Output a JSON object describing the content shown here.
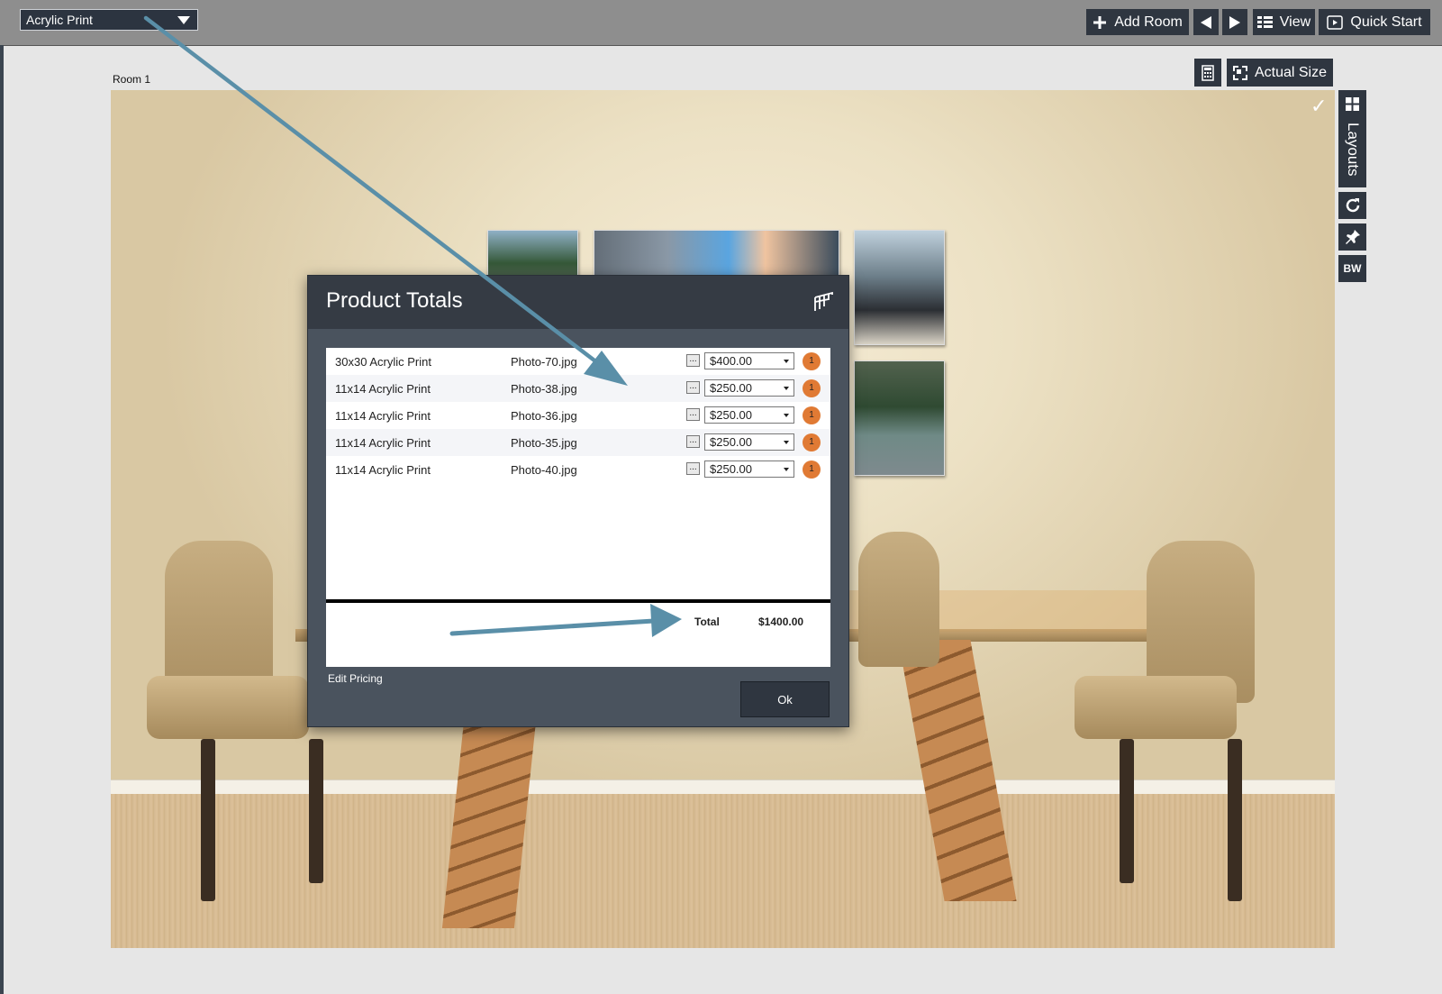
{
  "toolbar": {
    "product_select": "Acrylic Print",
    "add_room_label": "Add Room",
    "view_label": "View",
    "quick_start_label": "Quick Start"
  },
  "canvas": {
    "room_label": "Room 1",
    "actual_size_label": "Actual Size",
    "layouts_label": "Layouts",
    "bw_label": "BW"
  },
  "dialog": {
    "title": "Product Totals",
    "rows": [
      {
        "product": "30x30 Acrylic Print",
        "file": "Photo-70.jpg",
        "price": "$400.00",
        "qty": "1"
      },
      {
        "product": "11x14 Acrylic Print",
        "file": "Photo-38.jpg",
        "price": "$250.00",
        "qty": "1"
      },
      {
        "product": "11x14 Acrylic Print",
        "file": "Photo-36.jpg",
        "price": "$250.00",
        "qty": "1"
      },
      {
        "product": "11x14 Acrylic Print",
        "file": "Photo-35.jpg",
        "price": "$250.00",
        "qty": "1"
      },
      {
        "product": "11x14 Acrylic Print",
        "file": "Photo-40.jpg",
        "price": "$250.00",
        "qty": "1"
      }
    ],
    "dots_label": "...",
    "total_label": "Total",
    "total_value": "$1400.00",
    "edit_pricing_label": "Edit Pricing",
    "ok_label": "Ok"
  },
  "colors": {
    "toolbar_bg": "#8e8e8e",
    "button_bg": "#2f3640",
    "dialog_header": "#353b44",
    "qty_badge": "#e07a34",
    "annotation_arrow": "#5a8fa8"
  }
}
